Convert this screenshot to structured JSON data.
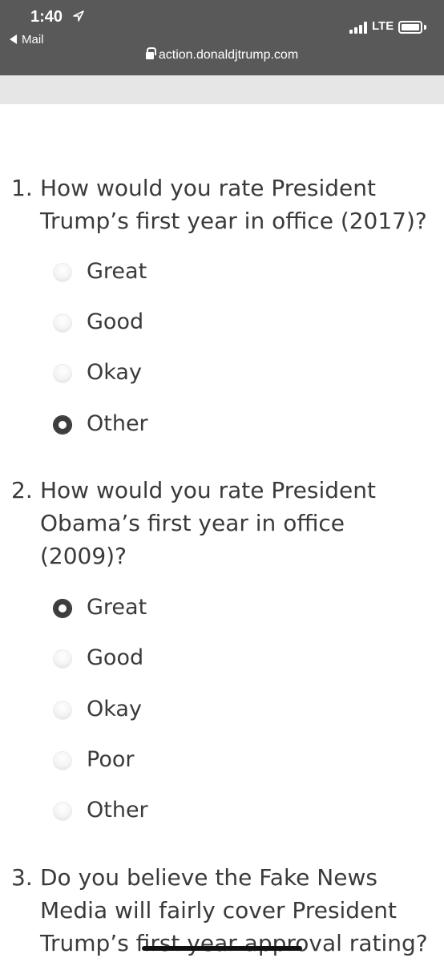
{
  "status_bar": {
    "time": "1:40",
    "back_app": "Mail",
    "network": "LTE"
  },
  "browser": {
    "url": "action.donaldjtrump.com"
  },
  "survey": {
    "questions": [
      {
        "number": "1.",
        "text": "How would you rate President Trump’s first year in office (2017)?",
        "options": [
          {
            "label": "Great",
            "selected": false
          },
          {
            "label": "Good",
            "selected": false
          },
          {
            "label": "Okay",
            "selected": false
          },
          {
            "label": "Other",
            "selected": true
          }
        ]
      },
      {
        "number": "2.",
        "text": "How would you rate President Obama’s first year in office (2009)?",
        "options": [
          {
            "label": "Great",
            "selected": true
          },
          {
            "label": "Good",
            "selected": false
          },
          {
            "label": "Okay",
            "selected": false
          },
          {
            "label": "Poor",
            "selected": false
          },
          {
            "label": "Other",
            "selected": false
          }
        ]
      },
      {
        "number": "3.",
        "text": "Do you believe the Fake News Media will fairly cover President Trump’s first year approval rating?"
      }
    ]
  }
}
